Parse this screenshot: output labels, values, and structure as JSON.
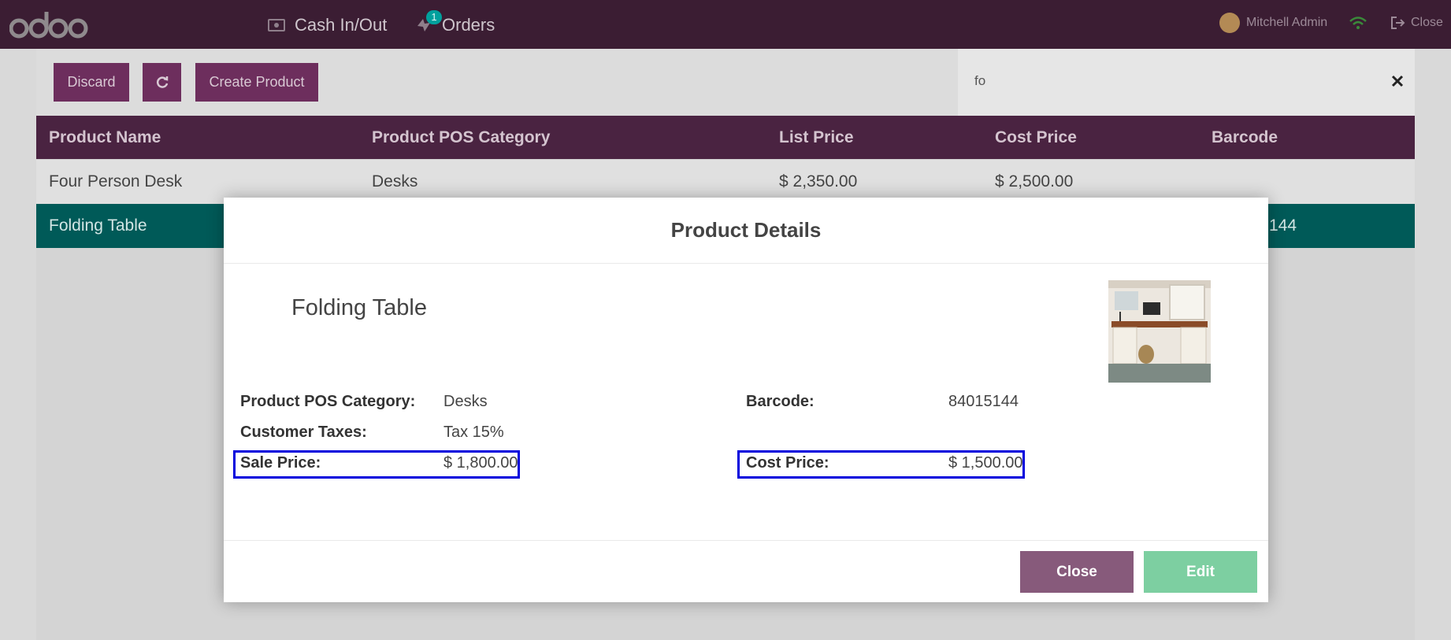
{
  "navbar": {
    "logo_text": "odoo",
    "cash_label": "Cash In/Out",
    "orders_label": "Orders",
    "orders_badge": "1",
    "user_name": "Mitchell Admin",
    "close_label": "Close"
  },
  "controls": {
    "discard_label": "Discard",
    "create_label": "Create Product",
    "search_value": "fo"
  },
  "table": {
    "headers": [
      "Product Name",
      "Product POS Category",
      "List Price",
      "Cost Price",
      "Barcode"
    ],
    "rows": [
      {
        "name": "Four Person Desk",
        "category": "Desks",
        "list_price": "$ 2,350.00",
        "cost_price": "$ 2,500.00",
        "barcode": ""
      },
      {
        "name": "Folding Table",
        "category": "",
        "list_price": "",
        "cost_price": "",
        "barcode": "144"
      }
    ]
  },
  "modal": {
    "title": "Product Details",
    "product_name": "Folding Table",
    "pos_category_label": "Product POS Category:",
    "pos_category_value": "Desks",
    "taxes_label": "Customer Taxes:",
    "taxes_value": "Tax 15%",
    "sale_price_label": "Sale Price:",
    "sale_price_value": "$ 1,800.00",
    "barcode_label": "Barcode:",
    "barcode_value": "84015144",
    "cost_price_label": "Cost Price:",
    "cost_price_value": "$ 1,500.00",
    "close_label": "Close",
    "edit_label": "Edit"
  },
  "colors": {
    "navbar_bg": "#3b1d33",
    "button_dark": "#6d2e5d",
    "selected_row": "#005a58",
    "close_button": "#875a7b",
    "edit_button": "#7dcfa1",
    "highlight_border": "#0000dd"
  }
}
